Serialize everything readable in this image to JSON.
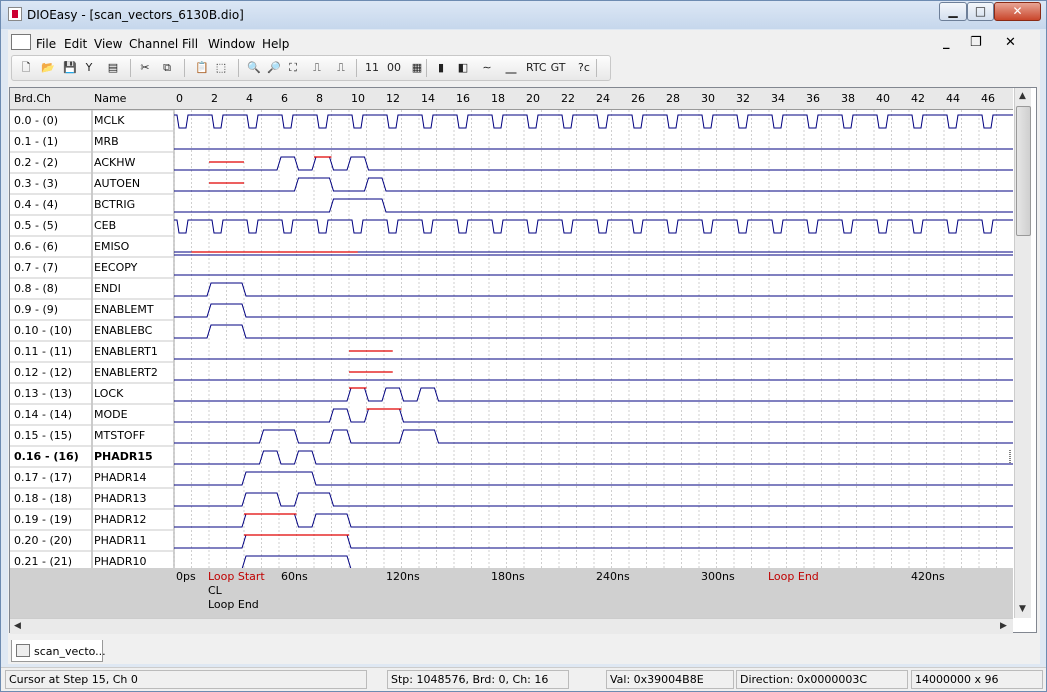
{
  "window": {
    "title": "DIOEasy - [scan_vectors_6130B.dio]",
    "min_icon": "minimize-icon",
    "max_icon": "maximize-icon",
    "close_icon": "close-icon"
  },
  "menu": {
    "items": [
      "File",
      "Edit",
      "View",
      "Channel",
      "Fill",
      "Window",
      "Help"
    ],
    "mdi_min": "_",
    "mdi_restore": "❐",
    "mdi_close": "✕"
  },
  "toolbar": {
    "buttons": [
      {
        "name": "new-button",
        "glyph": "🗋"
      },
      {
        "name": "open-button",
        "glyph": "📂"
      },
      {
        "name": "save-button",
        "glyph": "💾"
      },
      {
        "name": "filter-button",
        "glyph": "Y"
      },
      {
        "name": "print-button",
        "glyph": "▤"
      },
      {
        "name": "cut-button",
        "glyph": "✂"
      },
      {
        "name": "copy-button",
        "glyph": "⧉"
      },
      {
        "name": "paste-button",
        "glyph": "📋"
      },
      {
        "name": "select-button",
        "glyph": "⬚"
      },
      {
        "name": "zoom-button",
        "glyph": "🔍"
      },
      {
        "name": "zoom-in-button",
        "glyph": "🔎"
      },
      {
        "name": "zoom-fit-button",
        "glyph": "⛶"
      },
      {
        "name": "clock-pulse-button",
        "glyph": "⎍"
      },
      {
        "name": "pulse-button",
        "glyph": "⎍"
      },
      {
        "name": "ones-button",
        "glyph": "11"
      },
      {
        "name": "zeros-button",
        "glyph": "00"
      },
      {
        "name": "pattern-button",
        "glyph": "▦"
      },
      {
        "name": "marker-red-button",
        "glyph": "▮"
      },
      {
        "name": "marker-blue-button",
        "glyph": "◧"
      },
      {
        "name": "line-button",
        "glyph": "∼"
      },
      {
        "name": "step-button",
        "glyph": "⎽"
      },
      {
        "name": "rtc-button",
        "glyph": "RTC"
      },
      {
        "name": "gt-button",
        "glyph": "GT"
      },
      {
        "name": "help-button",
        "glyph": "?c"
      }
    ]
  },
  "grid": {
    "header_brd": "Brd.Ch",
    "header_name": "Name",
    "ticks": [
      "0",
      "2",
      "4",
      "6",
      "8",
      "10",
      "12",
      "14",
      "16",
      "18",
      "20",
      "22",
      "24",
      "26",
      "28",
      "30",
      "32",
      "34",
      "36",
      "38",
      "40",
      "42",
      "44",
      "46"
    ],
    "rows": [
      {
        "ch": "0.0  -  (0)",
        "name": "MCLK",
        "bold": false
      },
      {
        "ch": "0.1  -  (1)",
        "name": "MRB",
        "bold": false
      },
      {
        "ch": "0.2  -  (2)",
        "name": "ACKHW",
        "bold": false
      },
      {
        "ch": "0.3  -  (3)",
        "name": "AUTOEN",
        "bold": false
      },
      {
        "ch": "0.4  -  (4)",
        "name": "BCTRIG",
        "bold": false
      },
      {
        "ch": "0.5  -  (5)",
        "name": "CEB",
        "bold": false
      },
      {
        "ch": "0.6  -  (6)",
        "name": "EMISO",
        "bold": false
      },
      {
        "ch": "0.7  -  (7)",
        "name": "EECOPY",
        "bold": false
      },
      {
        "ch": "0.8  -  (8)",
        "name": "ENDI",
        "bold": false
      },
      {
        "ch": "0.9  -  (9)",
        "name": "ENABLEMT",
        "bold": false
      },
      {
        "ch": "0.10  -  (10)",
        "name": "ENABLEBC",
        "bold": false
      },
      {
        "ch": "0.11  -  (11)",
        "name": "ENABLERT1",
        "bold": false
      },
      {
        "ch": "0.12  -  (12)",
        "name": "ENABLERT2",
        "bold": false
      },
      {
        "ch": "0.13  -  (13)",
        "name": "LOCK",
        "bold": false
      },
      {
        "ch": "0.14  -  (14)",
        "name": "MODE",
        "bold": false
      },
      {
        "ch": "0.15  -  (15)",
        "name": "MTSTOFF",
        "bold": false
      },
      {
        "ch": "0.16  -  (16)",
        "name": "PHADR15",
        "bold": true
      },
      {
        "ch": "0.17  -  (17)",
        "name": "PHADR14",
        "bold": false
      },
      {
        "ch": "0.18  -  (18)",
        "name": "PHADR13",
        "bold": false
      },
      {
        "ch": "0.19  -  (19)",
        "name": "PHADR12",
        "bold": false
      },
      {
        "ch": "0.20  -  (20)",
        "name": "PHADR11",
        "bold": false
      },
      {
        "ch": "0.21  -  (21)",
        "name": "PHADR10",
        "bold": false
      }
    ],
    "waves": [
      {
        "type": "clock",
        "period": 2
      },
      {
        "type": "flat"
      },
      {
        "type": "pulses",
        "pulses": [
          [
            6,
            7
          ],
          [
            8,
            9
          ],
          [
            10,
            11
          ]
        ],
        "red": [
          [
            2,
            4
          ],
          [
            8,
            9
          ]
        ]
      },
      {
        "type": "pulses",
        "pulses": [
          [
            7,
            9
          ],
          [
            11,
            12
          ]
        ],
        "red": [
          [
            2,
            4
          ]
        ]
      },
      {
        "type": "pulses",
        "pulses": [
          [
            9,
            12
          ]
        ],
        "red": []
      },
      {
        "type": "clock",
        "period": 2
      },
      {
        "type": "double",
        "red": [
          [
            1,
            10.5
          ]
        ]
      },
      {
        "type": "flat"
      },
      {
        "type": "pulses",
        "pulses": [
          [
            2,
            4
          ]
        ],
        "red": []
      },
      {
        "type": "pulses",
        "pulses": [
          [
            2,
            4
          ]
        ],
        "red": []
      },
      {
        "type": "pulses",
        "pulses": [
          [
            2,
            4
          ]
        ],
        "red": []
      },
      {
        "type": "flat",
        "red": [
          [
            10,
            12.5
          ]
        ]
      },
      {
        "type": "flat",
        "red": [
          [
            10,
            12.5
          ]
        ]
      },
      {
        "type": "pulses",
        "pulses": [
          [
            10,
            11
          ],
          [
            12,
            13
          ],
          [
            14,
            15
          ]
        ],
        "red": [
          [
            10,
            11
          ]
        ]
      },
      {
        "type": "pulses",
        "pulses": [
          [
            9,
            10
          ],
          [
            11,
            13
          ]
        ],
        "red": [
          [
            11,
            13
          ]
        ]
      },
      {
        "type": "pulses",
        "pulses": [
          [
            5,
            7
          ],
          [
            9,
            10
          ],
          [
            13,
            15
          ]
        ],
        "red": []
      },
      {
        "type": "pulses",
        "pulses": [
          [
            5,
            6
          ],
          [
            7,
            8
          ]
        ],
        "red": []
      },
      {
        "type": "pulses",
        "pulses": [
          [
            4,
            8
          ]
        ],
        "red": []
      },
      {
        "type": "pulses",
        "pulses": [
          [
            4,
            6
          ],
          [
            7,
            9
          ]
        ],
        "red": []
      },
      {
        "type": "pulses",
        "pulses": [
          [
            4,
            7
          ],
          [
            8,
            10
          ]
        ],
        "red": [
          [
            4,
            7
          ]
        ]
      },
      {
        "type": "pulses",
        "pulses": [
          [
            4,
            10
          ]
        ],
        "red": [
          [
            4,
            10
          ]
        ]
      },
      {
        "type": "pulses",
        "pulses": [
          [
            4,
            10
          ]
        ],
        "red": []
      }
    ]
  },
  "footer": {
    "time_labels": [
      {
        "text": "0ps",
        "step": 0,
        "color": "#000"
      },
      {
        "text": "60ns",
        "step": 6,
        "color": "#000"
      },
      {
        "text": "120ns",
        "step": 12,
        "color": "#000"
      },
      {
        "text": "180ns",
        "step": 18,
        "color": "#000"
      },
      {
        "text": "240ns",
        "step": 24,
        "color": "#000"
      },
      {
        "text": "300ns",
        "step": 30,
        "color": "#000"
      },
      {
        "text": "420ns",
        "step": 42,
        "color": "#000"
      }
    ],
    "loop_start": "Loop Start",
    "cl": "CL",
    "loop_end_small": "Loop End",
    "loop_end": "Loop End",
    "loop_color": "#c00000"
  },
  "tab": {
    "label": "scan_vecto..."
  },
  "status": {
    "cursor": "Cursor at Step 15, Ch 0",
    "stp": "Stp: 1048576, Brd: 0, Ch: 16",
    "val": "Val: 0x39004B8E",
    "direction": "Direction: 0x0000003C",
    "size": "14000000 x 96"
  },
  "colors": {
    "wave": "#000080",
    "highlight": "#e00000",
    "grid": "#b0b0b0"
  }
}
